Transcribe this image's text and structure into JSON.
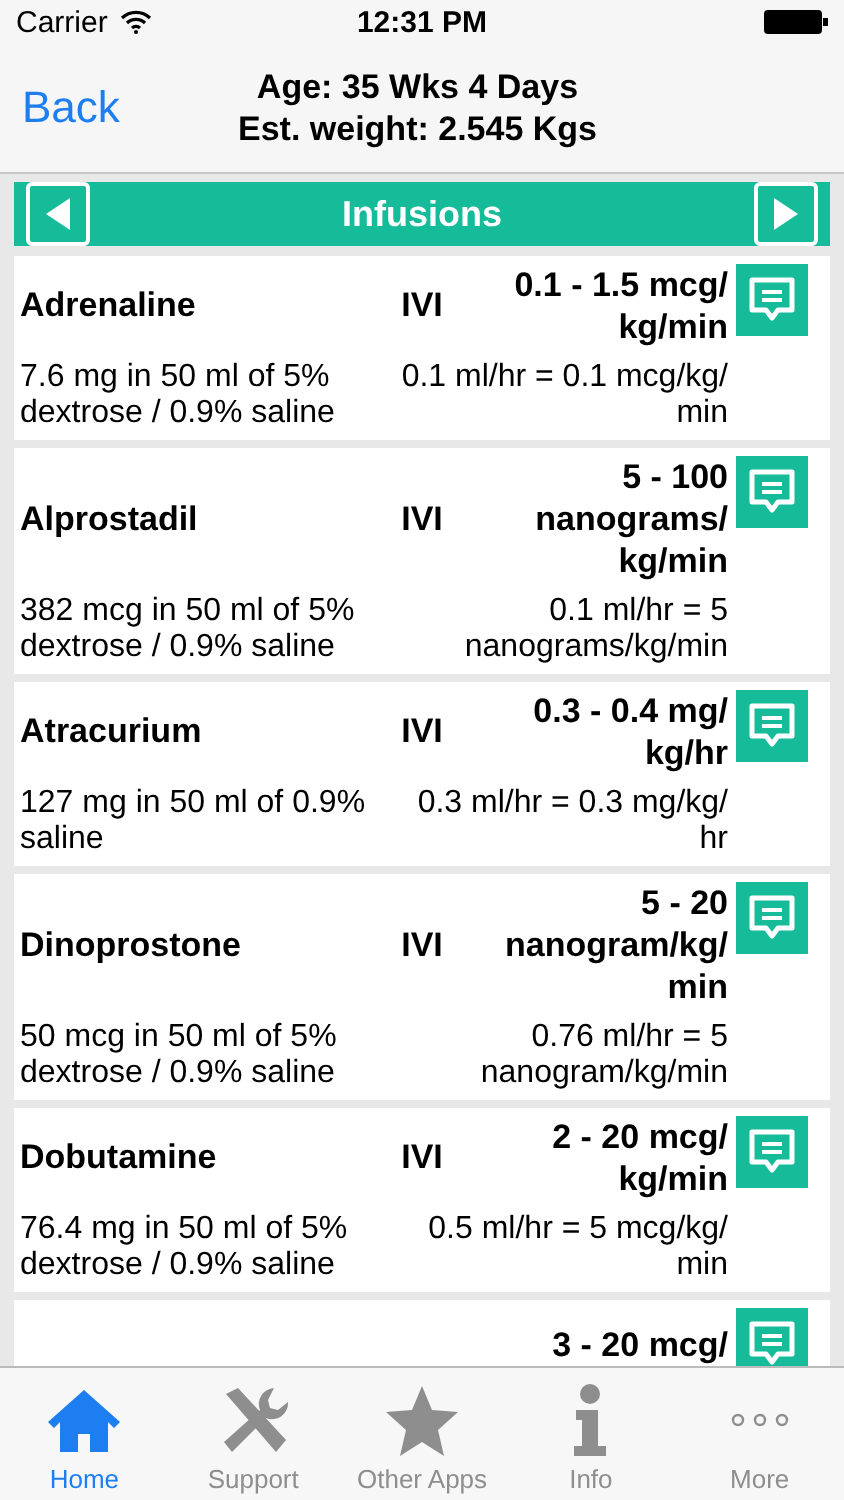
{
  "status_bar": {
    "carrier": "Carrier",
    "time": "12:31 PM"
  },
  "nav_bar": {
    "back": "Back",
    "title_lines": [
      "Age: 35 Wks 4 Days",
      "Est. weight: 2.545 Kgs"
    ]
  },
  "section": {
    "title": "Infusions"
  },
  "drugs": [
    {
      "name": "Adrenaline",
      "route": "IVI",
      "dose": "0.1 - 1.5 mcg/ kg/min",
      "preparation": "7.6 mg in 50 ml of 5% dextrose / 0.9% saline",
      "rate": "0.1 ml/hr = 0.1 mcg/kg/ min"
    },
    {
      "name": "Alprostadil",
      "route": "IVI",
      "dose": "5 - 100 nanograms/ kg/min",
      "preparation": "382 mcg in 50 ml of 5% dextrose / 0.9% saline",
      "rate": "0.1 ml/hr = 5 nanograms/kg/min"
    },
    {
      "name": "Atracurium",
      "route": "IVI",
      "dose": "0.3 - 0.4 mg/ kg/hr",
      "preparation": "127 mg in 50 ml of 0.9% saline",
      "rate": "0.3 ml/hr = 0.3 mg/kg/ hr"
    },
    {
      "name": "Dinoprostone",
      "route": "IVI",
      "dose": "5 - 20 nanogram/kg/ min",
      "preparation": "50 mcg in 50 ml of 5% dextrose / 0.9% saline",
      "rate": "0.76 ml/hr = 5 nanogram/kg/min"
    },
    {
      "name": "Dobutamine",
      "route": "IVI",
      "dose": "2 - 20 mcg/ kg/min",
      "preparation": "76.4 mg in 50 ml of 5% dextrose / 0.9% saline",
      "rate": "0.5 ml/hr = 5 mcg/kg/ min"
    },
    {
      "dose": "3 - 20 mcg/"
    }
  ],
  "tab_bar": [
    {
      "kind": "home",
      "label": "Home",
      "selected": true
    },
    {
      "kind": "tools",
      "label": "Support",
      "selected": false
    },
    {
      "kind": "star",
      "label": "Other Apps",
      "selected": false
    },
    {
      "kind": "info",
      "label": "Info",
      "selected": false
    },
    {
      "kind": "more",
      "label": "More",
      "selected": false
    }
  ]
}
